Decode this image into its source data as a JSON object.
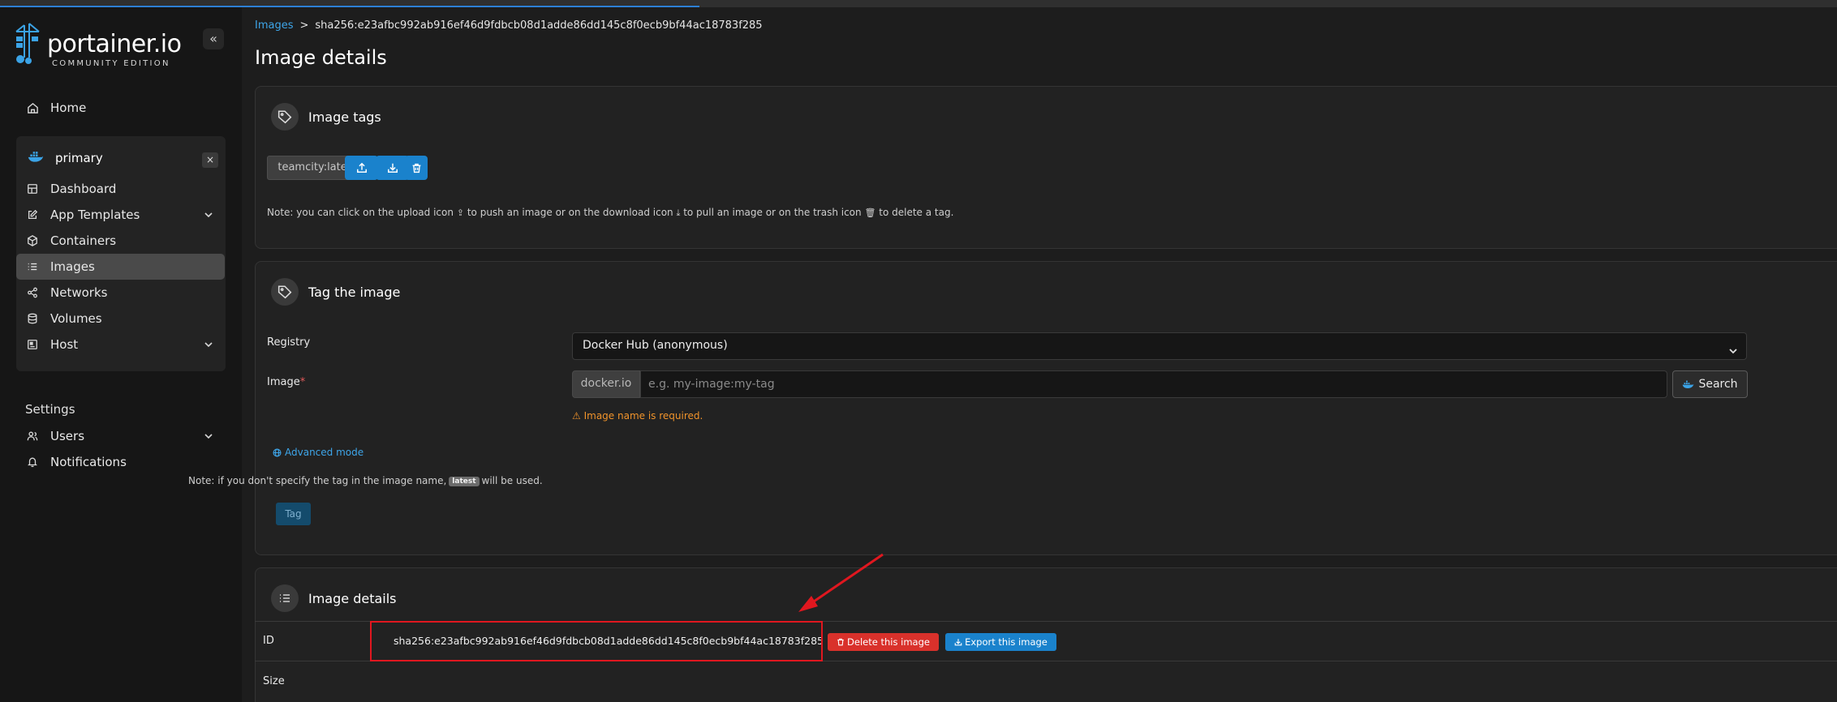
{
  "sidebar": {
    "brand": {
      "wordmark": "portainer.io",
      "edition": "COMMUNITY EDITION"
    },
    "collapse_glyph": "«",
    "home": "Home",
    "environment": {
      "name": "primary",
      "close_glyph": "×"
    },
    "env_items": [
      {
        "label": "Dashboard",
        "icon": "dashboard-icon"
      },
      {
        "label": "App Templates",
        "icon": "edit-icon",
        "chevron": true
      },
      {
        "label": "Containers",
        "icon": "box-icon"
      },
      {
        "label": "Images",
        "icon": "list-icon",
        "active": true
      },
      {
        "label": "Networks",
        "icon": "share-icon"
      },
      {
        "label": "Volumes",
        "icon": "database-icon"
      },
      {
        "label": "Host",
        "icon": "host-icon",
        "chevron": true
      }
    ],
    "settings_label": "Settings",
    "settings_items": [
      {
        "label": "Users",
        "icon": "users-icon",
        "chevron": true
      },
      {
        "label": "Notifications",
        "icon": "bell-icon"
      }
    ]
  },
  "breadcrumb": {
    "root": "Images",
    "separator": ">",
    "current": "sha256:e23afbc992ab916ef46d9fdbcb08d1adde86dd145c8f0ecb9bf44ac18783f285"
  },
  "page_title": "Image details",
  "image_tags": {
    "title": "Image tags",
    "tag": "teamcity:latest",
    "note": {
      "p1": "Note: you can click on the upload icon",
      "p2": "to push an image or on the download icon",
      "p3": "to pull an image or on the trash icon",
      "p4": "to delete a tag."
    }
  },
  "tag_image": {
    "title": "Tag the image",
    "registry_label": "Registry",
    "registry_value": "Docker Hub (anonymous)",
    "image_label": "Image",
    "required_mark": "*",
    "prefix": "docker.io",
    "image_placeholder": "e.g. my-image:my-tag",
    "search_label": "Search",
    "warning": "Image name is required.",
    "advanced_mode": "Advanced mode",
    "note_pre": "Note: if you don't specify the tag in the image name,",
    "note_badge": "latest",
    "note_post": "will be used.",
    "tag_button": "Tag"
  },
  "image_details": {
    "title": "Image details",
    "id_label": "ID",
    "id_value": "sha256:e23afbc992ab916ef46d9fdbcb08d1adde86dd145c8f0ecb9bf44ac18783f285",
    "delete_label": "Delete this image",
    "export_label": "Export this image",
    "size_label": "Size"
  },
  "colors": {
    "accent": "#1a82cc",
    "danger": "#d9312b",
    "warning": "#f0932b",
    "annotation": "#e0171f"
  }
}
